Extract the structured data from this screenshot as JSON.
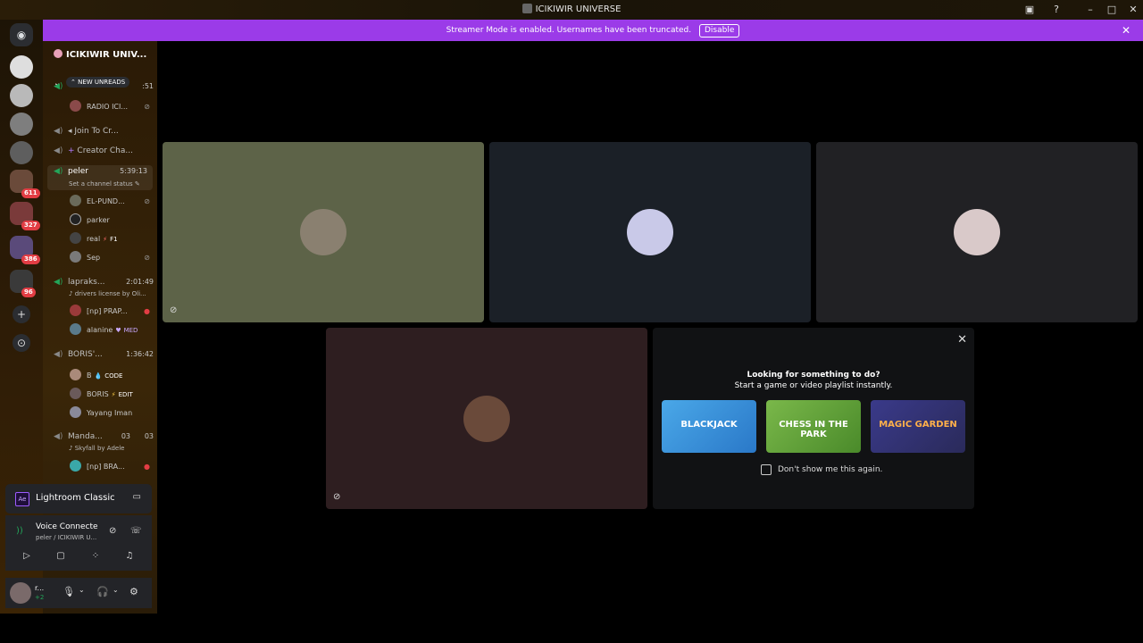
{
  "window": {
    "title": "ICIKIWIR UNIVERSE",
    "icons": [
      "inbox-icon",
      "help-icon",
      "minimize-icon",
      "maximize-icon",
      "close-icon"
    ]
  },
  "banner": {
    "text": "Streamer Mode is enabled. Usernames have been truncated.",
    "disable_label": "Disable",
    "color": "#9b3be8"
  },
  "server_rail": {
    "badges": [
      "611",
      "327",
      "386",
      "96"
    ]
  },
  "guild": {
    "name": "ICIKIWIR UNIV...",
    "new_unreads": "NEW UNREADS"
  },
  "channels": {
    "top_time": ":51",
    "radio": "RADIO ICI...",
    "join": "Join To Cr...",
    "creator": "Creator Cha...",
    "peler": {
      "name": "peler",
      "time": "5:39:13",
      "status": "Set a channel status"
    },
    "peler_users": [
      {
        "name": "EL-PUND..."
      },
      {
        "name": "parker"
      },
      {
        "name": "real",
        "tag": "F1"
      },
      {
        "name": "Sep"
      }
    ],
    "lapraks": {
      "name": "lapraks...",
      "time": "2:01:49",
      "status": "drivers license by Oli..."
    },
    "lapraks_users": [
      {
        "name": "[np] PRAP..."
      },
      {
        "name": "alanine",
        "tag": "MED"
      }
    ],
    "boris": {
      "name": "BORIS'...",
      "time": "1:36:42"
    },
    "boris_users": [
      {
        "name": "B",
        "tag": "CODE"
      },
      {
        "name": "BORIS",
        "tag": "EDIT"
      },
      {
        "name": "Yayang Iman"
      }
    ],
    "manda": {
      "name": "Manda...",
      "count1": "03",
      "count2": "03",
      "status": "Skyfall by Adele"
    },
    "manda_users": [
      {
        "name": "[np] BRA..."
      }
    ]
  },
  "activity": {
    "badge": "Ae",
    "name": "Lightroom Classic"
  },
  "voice": {
    "status": "Voice Connected",
    "sub": "peler / ICIKIWIR U..."
  },
  "user": {
    "name": "r...",
    "status": "+2"
  },
  "tiles": [
    {
      "color": "#5d6348",
      "avatar": "#8a8070"
    },
    {
      "color": "#1b2027",
      "avatar": "#c9c9e8"
    },
    {
      "color": "#212124",
      "avatar": "#d9c9c9"
    },
    {
      "color": "#2e1e20",
      "avatar": "#6a4a3a"
    }
  ],
  "activity_panel": {
    "line1": "Looking for something to do?",
    "line2": "Start a game or video playlist instantly.",
    "games": [
      "BLACKJACK",
      "CHESS IN THE PARK",
      "MAGIC GARDEN"
    ],
    "checkbox_label": "Don't show me this again."
  }
}
